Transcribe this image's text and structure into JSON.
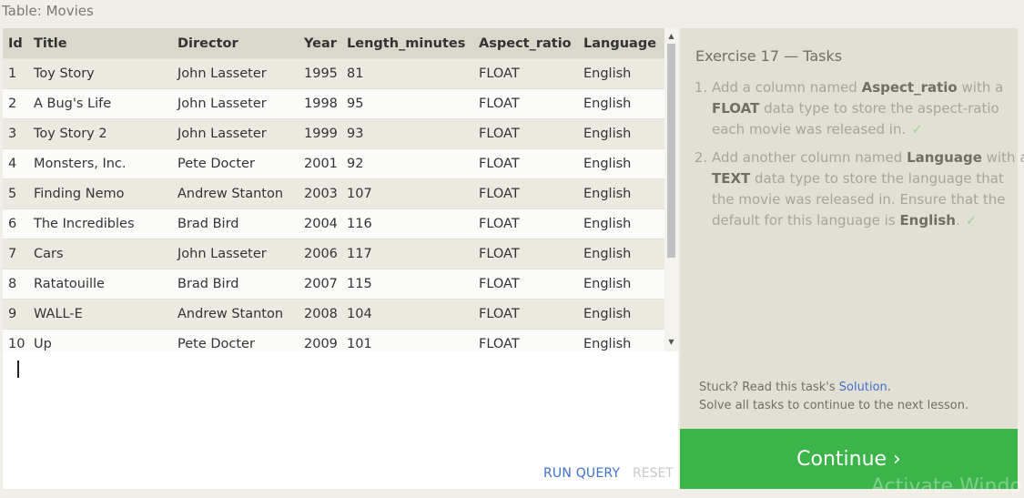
{
  "table": {
    "caption": "Table: Movies",
    "columns": [
      "Id",
      "Title",
      "Director",
      "Year",
      "Length_minutes",
      "Aspect_ratio",
      "Language"
    ],
    "rows": [
      [
        "1",
        "Toy Story",
        "John Lasseter",
        "1995",
        "81",
        "FLOAT",
        "English"
      ],
      [
        "2",
        "A Bug's Life",
        "John Lasseter",
        "1998",
        "95",
        "FLOAT",
        "English"
      ],
      [
        "3",
        "Toy Story 2",
        "John Lasseter",
        "1999",
        "93",
        "FLOAT",
        "English"
      ],
      [
        "4",
        "Monsters, Inc.",
        "Pete Docter",
        "2001",
        "92",
        "FLOAT",
        "English"
      ],
      [
        "5",
        "Finding Nemo",
        "Andrew Stanton",
        "2003",
        "107",
        "FLOAT",
        "English"
      ],
      [
        "6",
        "The Incredibles",
        "Brad Bird",
        "2004",
        "116",
        "FLOAT",
        "English"
      ],
      [
        "7",
        "Cars",
        "John Lasseter",
        "2006",
        "117",
        "FLOAT",
        "English"
      ],
      [
        "8",
        "Ratatouille",
        "Brad Bird",
        "2007",
        "115",
        "FLOAT",
        "English"
      ],
      [
        "9",
        "WALL-E",
        "Andrew Stanton",
        "2008",
        "104",
        "FLOAT",
        "English"
      ],
      [
        "10",
        "Up",
        "Pete Docter",
        "2009",
        "101",
        "FLOAT",
        "English"
      ]
    ]
  },
  "scrollbar": {
    "up_arrow": "▲",
    "down_arrow": "▼"
  },
  "editor": {
    "run_label": "RUN QUERY",
    "reset_label": "RESET"
  },
  "tasks": {
    "title": "Exercise 17 — Tasks",
    "task1": {
      "pre": "Add a column named ",
      "b1": "Aspect_ratio",
      "mid": " with a ",
      "b2": "FLOAT",
      "post": " data type to store the aspect-ratio each movie was released in.",
      "check": "✓"
    },
    "task2": {
      "pre": "Add another column named ",
      "b1": "Language",
      "mid": " with a ",
      "b2": "TEXT",
      "post": " data type to store the language that the movie was released in. Ensure that the default for this language is ",
      "b3": "English",
      "end": ".",
      "check": "✓"
    },
    "stuck_pre": "Stuck? Read this task's ",
    "solution_link": "Solution",
    "stuck_post": ".",
    "solve_all": "Solve all tasks to continue to the next lesson."
  },
  "continue_label": "Continue ›",
  "watermark": "Activate Windows",
  "colors": {
    "accent_green": "#3bb54a",
    "link_blue": "#3f6fd0",
    "header_bg": "#d9d8ca",
    "panel_bg": "#e2e0d5"
  }
}
